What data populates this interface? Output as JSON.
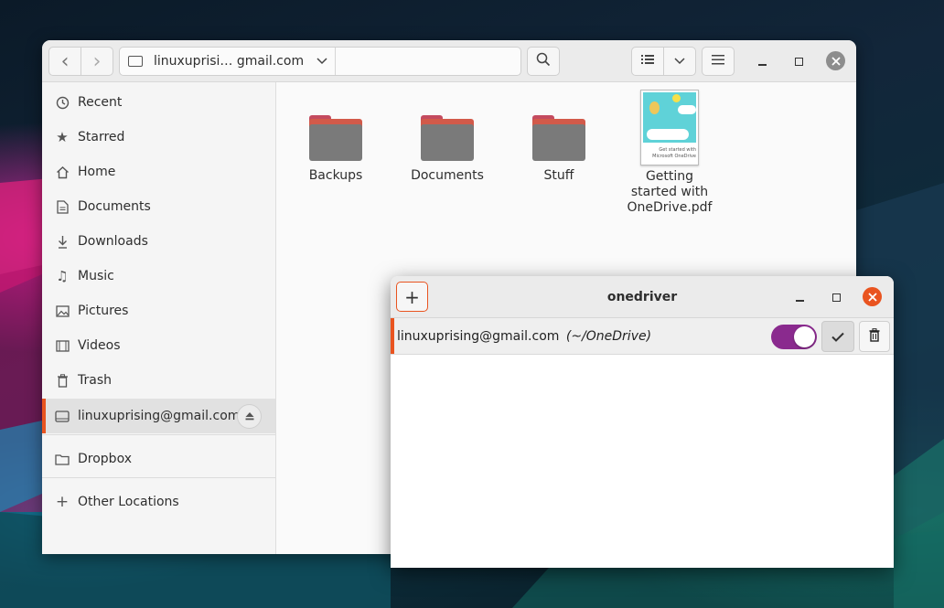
{
  "files": {
    "back_label": "‹",
    "forward_label": "›",
    "path_label": "linuxuprisi… gmail.com",
    "search_icon": "search-icon",
    "view_icon": "list-view-icon",
    "menu_icon": "hamburger-menu-icon",
    "sidebar": {
      "items": [
        {
          "label": "Recent",
          "icon": "clock-icon"
        },
        {
          "label": "Starred",
          "icon": "star-icon"
        },
        {
          "label": "Home",
          "icon": "home-icon"
        },
        {
          "label": "Documents",
          "icon": "document-icon"
        },
        {
          "label": "Downloads",
          "icon": "download-icon"
        },
        {
          "label": "Music",
          "icon": "music-icon"
        },
        {
          "label": "Pictures",
          "icon": "picture-icon"
        },
        {
          "label": "Videos",
          "icon": "video-icon"
        },
        {
          "label": "Trash",
          "icon": "trash-icon"
        }
      ],
      "mount_label": "linuxuprising@gmail.com",
      "dropbox_label": "Dropbox",
      "other_label": "Other Locations"
    },
    "items": [
      {
        "name": "Backups",
        "type": "folder"
      },
      {
        "name": "Documents",
        "type": "folder"
      },
      {
        "name": "Stuff",
        "type": "folder"
      },
      {
        "name": "Getting started with OneDrive.pdf",
        "type": "pdf",
        "thumb_text": "Get started with Microsoft OneDrive"
      }
    ]
  },
  "onedriver": {
    "title": "onedriver",
    "add_label": "+",
    "account": {
      "email": "linuxuprising@gmail.com",
      "mount_path": "(~/OneDrive)",
      "enabled": true
    },
    "accent": "#e95420",
    "toggle_color": "#8a2a8e"
  }
}
